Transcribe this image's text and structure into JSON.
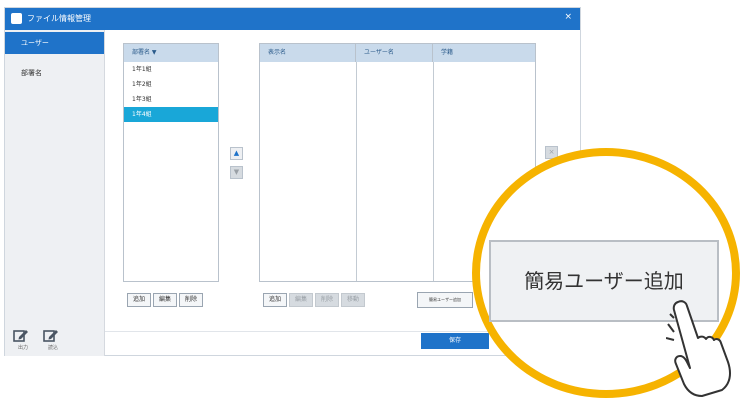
{
  "window": {
    "title": "ファイル情報管理",
    "close_glyph": "×"
  },
  "sidebar": {
    "items": [
      {
        "label": "ユーザー"
      },
      {
        "label": "部署名"
      }
    ],
    "bottom_icons": [
      {
        "icon": "edit-icon",
        "label": "出力"
      },
      {
        "icon": "edit-icon",
        "label": "読込"
      }
    ]
  },
  "dept_panel": {
    "header": "部署名 ▼",
    "items": [
      "1年1組",
      "1年2組",
      "1年3組",
      "1年4組"
    ],
    "selected_index": 3,
    "buttons": [
      "追加",
      "編集",
      "削除"
    ]
  },
  "move_buttons": {
    "up": "▲",
    "down": "▼"
  },
  "user_panel": {
    "headers": [
      "表示名",
      "ユーザー名",
      "学籍"
    ],
    "buttons": [
      "追加",
      "編集",
      "削除",
      "移動",
      "簡易ユーザー追加"
    ],
    "side_button": "×"
  },
  "footer": {
    "primary_label": "保存"
  },
  "callout": {
    "button_label": "簡易ユーザー追加"
  },
  "colors": {
    "accent": "#1f73c9",
    "selected": "#19a7d8",
    "callout_ring": "#f6b300"
  }
}
